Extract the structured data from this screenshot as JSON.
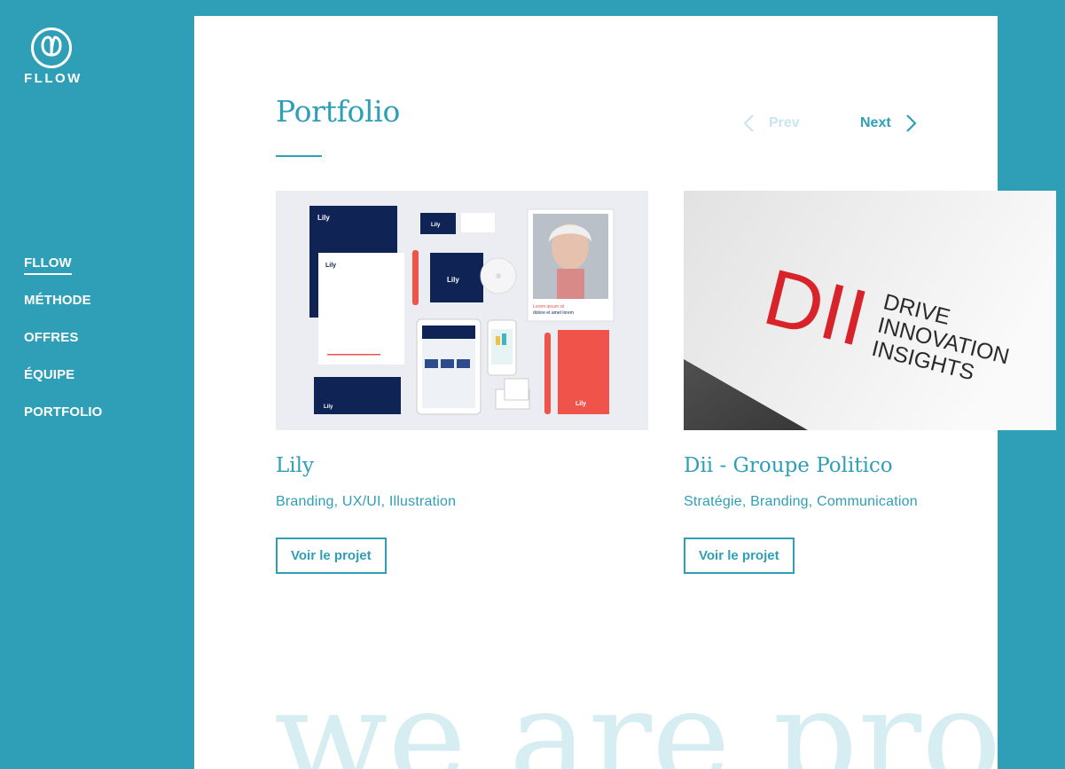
{
  "brand": {
    "name": "FLLOW"
  },
  "nav": {
    "items": [
      {
        "label": "FLLOW",
        "active": true
      },
      {
        "label": "MÉTHODE",
        "active": false
      },
      {
        "label": "OFFRES",
        "active": false
      },
      {
        "label": "ÉQUIPE",
        "active": false
      },
      {
        "label": "PORTFOLIO",
        "active": false
      }
    ]
  },
  "portfolio": {
    "title": "Portfolio",
    "prev_label": "Prev",
    "next_label": "Next",
    "prev_disabled": true,
    "projects": [
      {
        "title": "Lily",
        "tags": "Branding, UX/UI, Illustration",
        "button": "Voir le projet",
        "image": {
          "brand_text": "Lily",
          "poster_caption_1": "Lorem ipsum sit",
          "poster_caption_2": "dolore et amet lorem"
        }
      },
      {
        "title": "Dii - Groupe Politico",
        "tags": "Stratégie, Branding, Communication",
        "button": "Voir le projet",
        "image": {
          "logo_letters": "DII",
          "line1": "DRIVE",
          "line2": "INNOVATION",
          "line3": "INSIGHTS"
        }
      }
    ]
  },
  "background_text": "we are proj",
  "colors": {
    "accent": "#2e9fb6",
    "navy": "#0f2355",
    "coral": "#f0534a",
    "dii_red": "#d8232a"
  }
}
